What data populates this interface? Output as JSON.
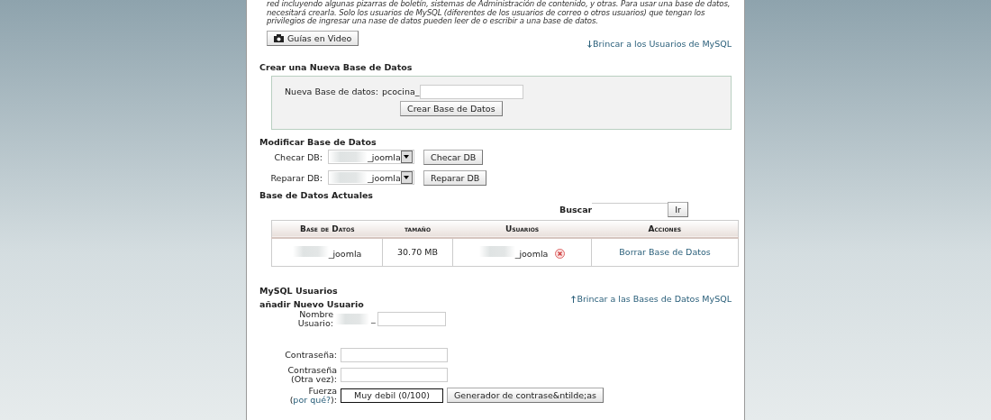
{
  "intro": "red incluyendo algunas pizarras de boletín, sistemas de Administración de contenido, y otras. Para usar una base de datos,\nnecesitará crearla. Solo los usuarios de MySQL (diferentes de los usuarios de correo o otros usuarios) que tengan los\nprivilegios de ingresar una nase de datos pueden leer de o escribir a una base de datos.",
  "video_button": "Guías en Video",
  "jump_users": "Brincar a los Usuarios de MySQL",
  "create": {
    "heading": "Crear una Nueva Base de Datos",
    "label": "Nueva Base de datos:",
    "prefix": "pcocina_",
    "button": "Crear Base de Datos"
  },
  "modify": {
    "heading": "Modificar Base de Datos",
    "rows": [
      {
        "label": "Checar DB:",
        "value": "_joomla",
        "button": "Checar DB"
      },
      {
        "label": "Reparar DB:",
        "value": "_joomla",
        "button": "Reparar DB"
      }
    ]
  },
  "current": {
    "heading": "Base de Datos Actuales",
    "search_label": "Buscar",
    "go_button": "Ir",
    "columns": [
      "Base de Datos",
      "tamaño",
      "Usuarios",
      "Acciones"
    ],
    "rows": [
      {
        "database": "_joomla",
        "size": "30.70 MB",
        "user": "_joomla",
        "action": "Borrar Base de Datos"
      }
    ]
  },
  "users": {
    "heading": "MySQL Usuarios",
    "jump_databases": "Brincar a las Bases de Datos MySQL",
    "subheading": "añadir Nuevo Usuario",
    "fields": [
      {
        "kind": "username",
        "label": "Nombre Usuario:",
        "prefix": "_"
      },
      {
        "kind": "password",
        "label": "Contraseña:"
      },
      {
        "kind": "password",
        "label": "Contraseña (Otra vez):"
      }
    ],
    "strength": {
      "label": "Fuerza (",
      "link": "por qué?",
      "suffix": "):",
      "meter": "Muy debil (0/100)",
      "level": 0,
      "generator": "Generador de contrase&ntilde;as"
    }
  }
}
